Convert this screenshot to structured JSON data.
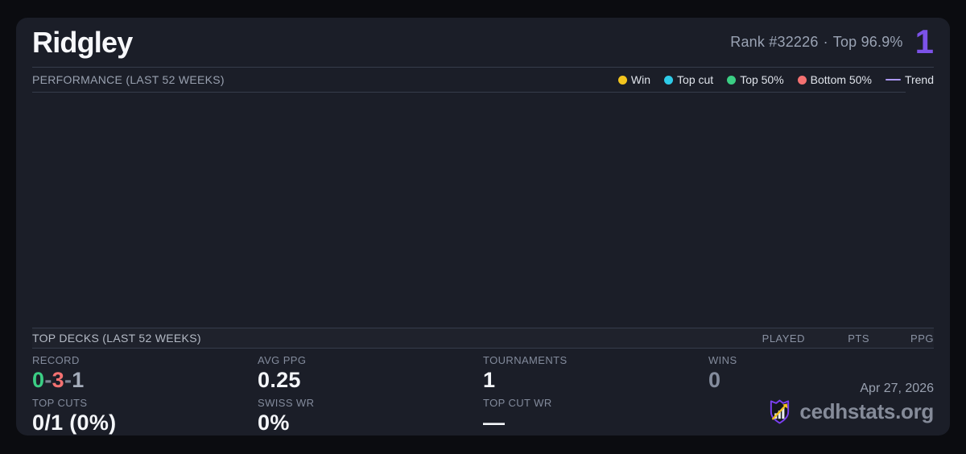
{
  "player": {
    "name": "Ridgley",
    "rank_label": "Rank #32226",
    "separator": "·",
    "top_percent": "Top 96.9%",
    "big_number": "1"
  },
  "performance": {
    "title": "PERFORMANCE (LAST 52 WEEKS)",
    "legend": [
      {
        "label": "Win",
        "color": "#f3c51e",
        "marker": "dot"
      },
      {
        "label": "Top cut",
        "color": "#2ecbe8",
        "marker": "dot"
      },
      {
        "label": "Top 50%",
        "color": "#3bce84",
        "marker": "dot"
      },
      {
        "label": "Bottom 50%",
        "color": "#f47171",
        "marker": "dot"
      },
      {
        "label": "Trend",
        "color": "#ab97f5",
        "marker": "line"
      }
    ]
  },
  "chart_data": {
    "type": "scatter",
    "title": "PERFORMANCE (LAST 52 WEEKS)",
    "series": [],
    "annotations": "chart plot area is empty (no data points, no axes visible)"
  },
  "top_decks": {
    "title": "TOP DECKS (LAST 52 WEEKS)",
    "columns": [
      "PLAYED",
      "PTS",
      "PPG"
    ],
    "rows": []
  },
  "stats": {
    "record": {
      "label": "RECORD",
      "wins": "0",
      "sep": "-",
      "losses": "3",
      "draws": "1"
    },
    "avg_ppg": {
      "label": "AVG PPG",
      "value": "0.25"
    },
    "tournaments": {
      "label": "TOURNAMENTS",
      "value": "1"
    },
    "wins": {
      "label": "WINS",
      "value": "0"
    },
    "top_cuts": {
      "label": "TOP CUTS",
      "value": "0/1 (0%)"
    },
    "swiss_wr": {
      "label": "SWISS WR",
      "value": "0%"
    },
    "top_cut_wr": {
      "label": "TOP CUT WR",
      "value": "—"
    }
  },
  "footer": {
    "date": "Apr 27, 2026",
    "brand": "cedhstats.org",
    "logo_icon": "shield-chart-arrow-icon"
  },
  "colors": {
    "accent_purple": "#7c52e8",
    "win_green": "#3bce84",
    "loss_red": "#f47171",
    "draw_gray": "#a4acba",
    "dash_gray": "#7e8595",
    "muted_value": "#848c9d",
    "card_bg": "#1b1e28",
    "page_bg": "#0b0c10",
    "divider": "#363c4b"
  }
}
